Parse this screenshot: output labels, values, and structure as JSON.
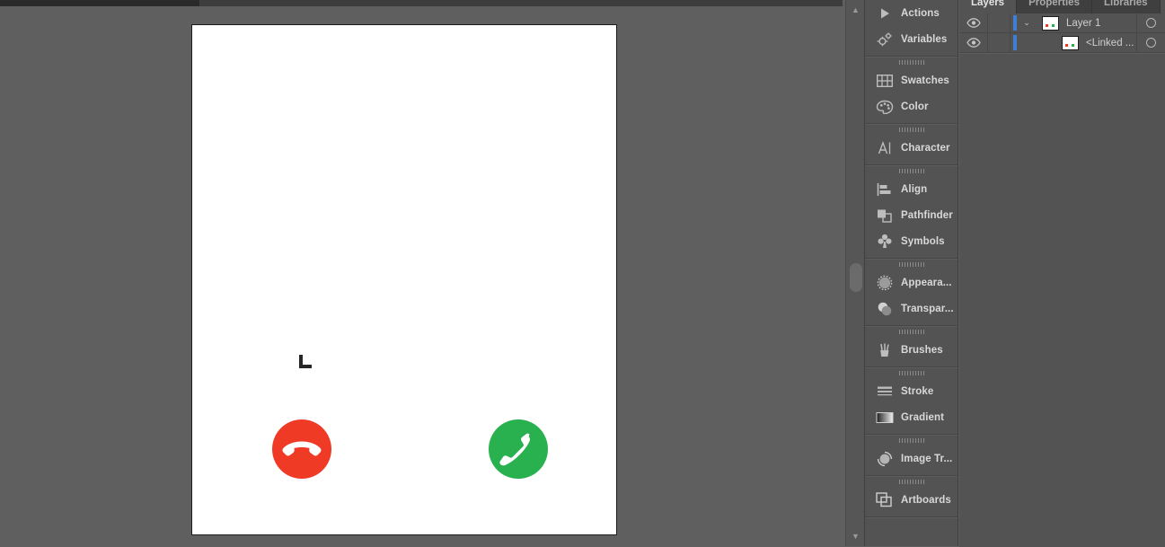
{
  "app": {
    "workspace": "illustrator-like-editor"
  },
  "canvas": {
    "artboard_background": "#ffffff",
    "background": "#5f5f5f",
    "corner_mark": "crop-corner-mark",
    "buttons": [
      {
        "name": "decline-call",
        "icon": "phone-hangup-icon",
        "color": "#ef3b26"
      },
      {
        "name": "accept-call",
        "icon": "phone-receiver-icon",
        "color": "#2ab14f"
      }
    ]
  },
  "scrollbar": {
    "up_arrow": "▲",
    "down_arrow": "▼"
  },
  "dock": {
    "groups": [
      {
        "grip": false,
        "items": [
          {
            "label": "Actions",
            "icon": "play-triangle-icon"
          },
          {
            "label": "Variables",
            "icon": "gears-icon"
          }
        ]
      },
      {
        "grip": true,
        "items": [
          {
            "label": "Swatches",
            "icon": "swatches-grid-icon"
          },
          {
            "label": "Color",
            "icon": "color-palette-icon"
          }
        ]
      },
      {
        "grip": true,
        "items": [
          {
            "label": "Character",
            "icon": "character-a-icon"
          }
        ]
      },
      {
        "grip": true,
        "items": [
          {
            "label": "Align",
            "icon": "align-left-icon"
          },
          {
            "label": "Pathfinder",
            "icon": "pathfinder-squares-icon"
          },
          {
            "label": "Symbols",
            "icon": "symbols-clover-icon"
          }
        ]
      },
      {
        "grip": true,
        "items": [
          {
            "label": "Appeara...",
            "icon": "appearance-circle-icon"
          },
          {
            "label": "Transpar...",
            "icon": "transparency-circles-icon"
          }
        ]
      },
      {
        "grip": true,
        "items": [
          {
            "label": "Brushes",
            "icon": "brushes-icon"
          }
        ]
      },
      {
        "grip": true,
        "items": [
          {
            "label": "Stroke",
            "icon": "stroke-lines-icon"
          },
          {
            "label": "Gradient",
            "icon": "gradient-swatch-icon"
          }
        ]
      },
      {
        "grip": true,
        "items": [
          {
            "label": "Image Tr...",
            "icon": "image-trace-icon"
          }
        ]
      },
      {
        "grip": true,
        "items": [
          {
            "label": "Artboards",
            "icon": "artboards-icon"
          }
        ]
      }
    ]
  },
  "layers_panel": {
    "tabs": [
      {
        "label": "Layers",
        "active": true
      },
      {
        "label": "Properties",
        "active": false
      },
      {
        "label": "Libraries",
        "active": false
      }
    ],
    "rows": [
      {
        "name": "Layer 1",
        "eye": "eye-visible-icon",
        "twisty": "⌄",
        "color": "#3d7fd4",
        "target": "target-circle-icon",
        "child": false
      },
      {
        "name": "<Linked ...",
        "eye": "eye-visible-icon",
        "twisty": "",
        "color": "#3d7fd4",
        "target": "target-circle-icon",
        "child": true
      }
    ]
  }
}
